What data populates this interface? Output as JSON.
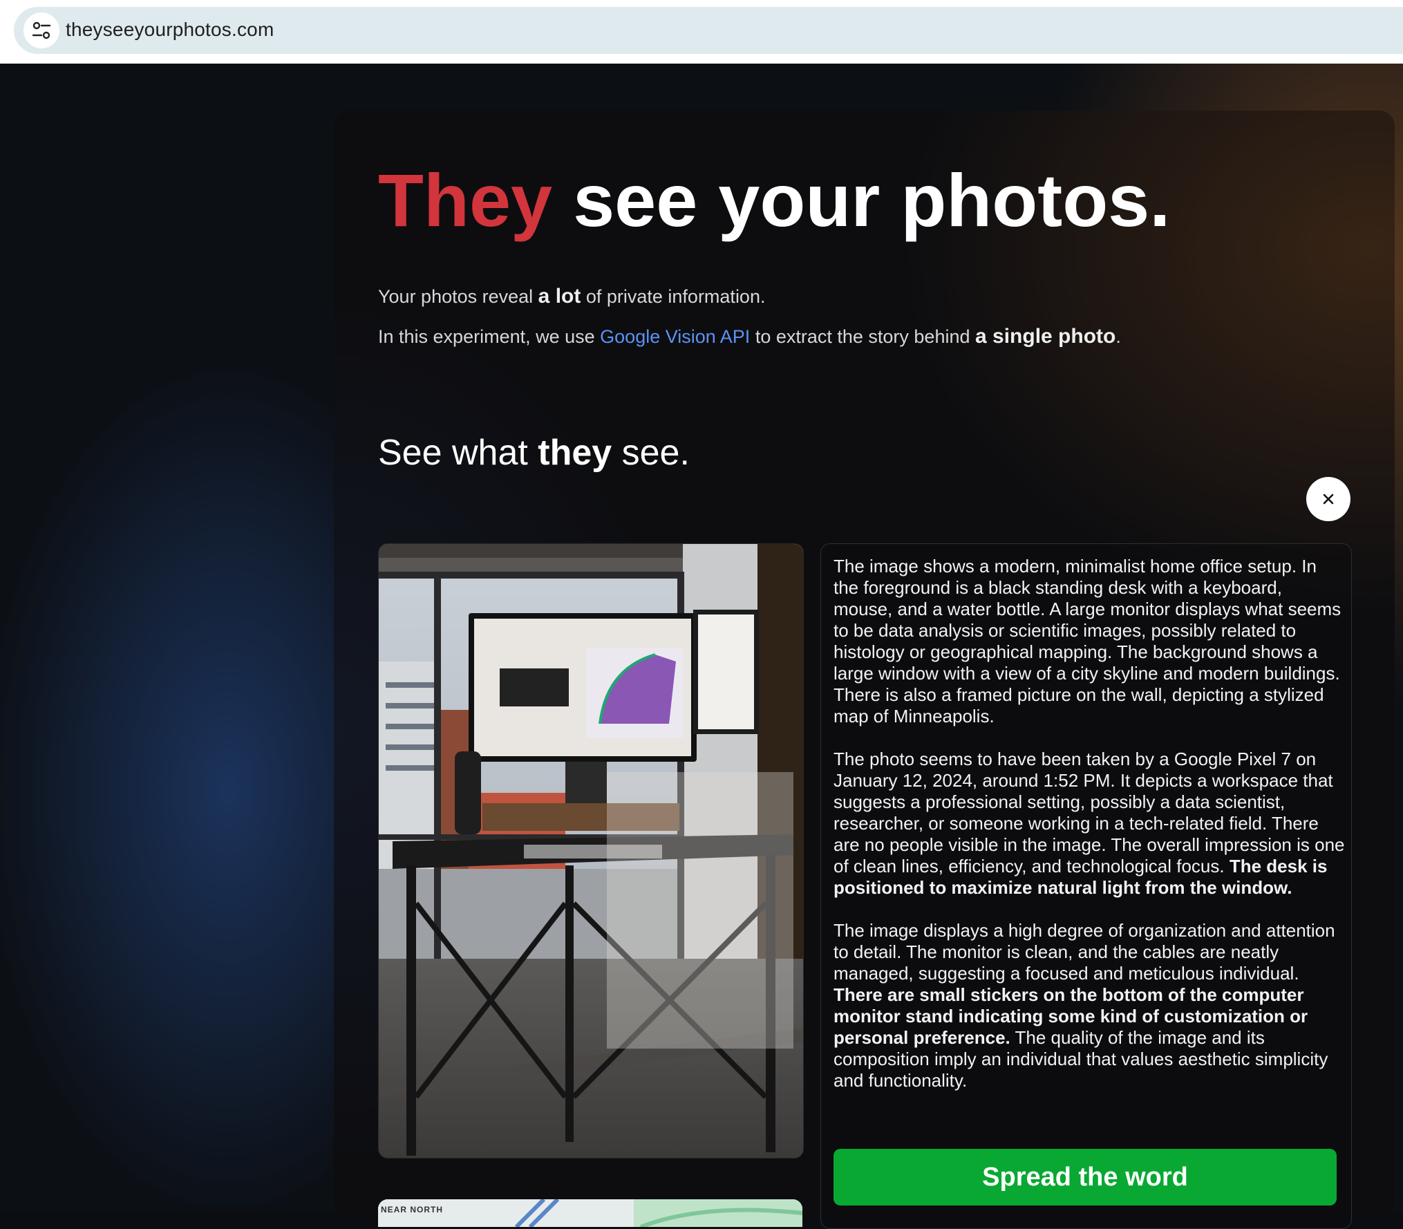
{
  "browser": {
    "url": "theyseeyourphotos.com",
    "site_icon": "tune-icon"
  },
  "hero": {
    "title_accent": "They",
    "title_rest": "see your photos."
  },
  "intro": {
    "line1_pre": "Your photos reveal ",
    "line1_bold": "a lot",
    "line1_post": " of private information.",
    "line2_pre": "In this experiment, we use ",
    "line2_link": "Google Vision API",
    "line2_mid": " to extract the story behind ",
    "line2_bold": "a single photo",
    "line2_post": "."
  },
  "section": {
    "pre": "See what ",
    "bold": "they",
    "post": " see."
  },
  "close_icon": "close-icon",
  "analysis": {
    "p1": "The image shows a modern, minimalist home office setup. In the foreground is a black standing desk with a keyboard, mouse, and a water bottle. A large monitor displays what seems to be data analysis or scientific images, possibly related to histology or geographical mapping. The background shows a large window with a view of a city skyline and modern buildings. There is also a framed picture on the wall, depicting a stylized map of Minneapolis.",
    "p2_plain": "The photo seems to have been taken by a Google Pixel 7 on January 12, 2024, around 1:52 PM. It depicts a workspace that suggests a professional setting, possibly a data scientist, researcher, or someone working in a tech-related field. There are no people visible in the image. The overall impression is one of clean lines, efficiency, and technological focus. ",
    "p2_bold": "The desk is positioned to maximize natural light from the window.",
    "p3_plain": "The image displays a high degree of organization and attention to detail. The monitor is clean, and the cables are neatly managed, suggesting a focused and meticulous individual. ",
    "p3_bold": "There are small stickers on the bottom of the computer monitor stand indicating some kind of customization or personal preference.",
    "p3_post": " The quality of the image and its composition imply an individual that values aesthetic simplicity and functionality."
  },
  "spread_button": "Spread the word",
  "map_preview_label": "NEAR NORTH",
  "colors": {
    "accent_red": "#d2353b",
    "link_blue": "#5c93f4",
    "button_green": "#09a832"
  }
}
